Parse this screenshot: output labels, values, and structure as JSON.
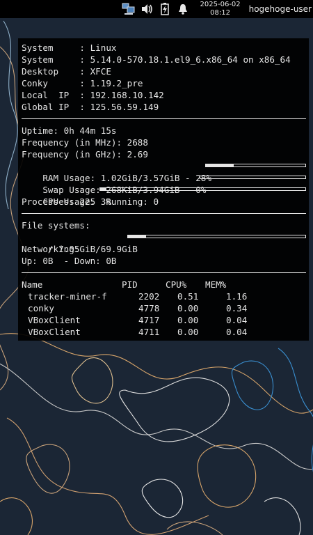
{
  "panel": {
    "clock_date": "2025-06-02",
    "clock_time": "08:12",
    "user": "hogehoge-user",
    "icons": [
      "network-icon",
      "volume-icon",
      "battery-icon",
      "notification-bell-icon"
    ]
  },
  "conky": {
    "system_rows": [
      {
        "label": "System     ",
        "value": "Linux"
      },
      {
        "label": "System     ",
        "value": "5.14.0-570.18.1.el9_6.x86_64 on x86_64"
      },
      {
        "label": "Desktop    ",
        "value": "XFCE"
      },
      {
        "label": "Conky      ",
        "value": "1.19.2_pre"
      },
      {
        "label": "Local  IP  ",
        "value": "192.168.10.142"
      },
      {
        "label": "Global IP  ",
        "value": "125.56.59.149"
      }
    ],
    "uptime": "Uptime: 0h 44m 15s",
    "freq_mhz": "Frequency (in MHz): 2688",
    "freq_ghz": "Frequency (in GHz): 2.69",
    "ram": {
      "text": "RAM Usage: 1.02GiB/3.57GiB - 28%",
      "percent": 28
    },
    "swap": {
      "text": "Swap Usage: 268KiB/3.94GiB - 0%",
      "percent": 0
    },
    "cpu": {
      "text": "CPU Usage: 3%",
      "percent": 3
    },
    "processes": "Processes: 225  Running: 0",
    "fs_header": "File systems:",
    "fs_root": {
      "text": " / 7.05GiB/69.9GiB",
      "percent": 10
    },
    "net_header": "Networking:",
    "net_line": "Up: 0B  - Down: 0B",
    "proc_header": {
      "name": "Name",
      "pid": "PID",
      "cpu": "CPU%",
      "mem": "MEM%"
    },
    "processes_table": [
      {
        "name": "tracker-miner-f",
        "pid": "2202",
        "cpu": "0.51",
        "mem": "1.16"
      },
      {
        "name": "conky",
        "pid": "4778",
        "cpu": "0.00",
        "mem": "0.34"
      },
      {
        "name": "VBoxClient",
        "pid": "4717",
        "cpu": "0.00",
        "mem": "0.04"
      },
      {
        "name": "VBoxClient",
        "pid": "4711",
        "cpu": "0.00",
        "mem": "0.04"
      }
    ]
  }
}
